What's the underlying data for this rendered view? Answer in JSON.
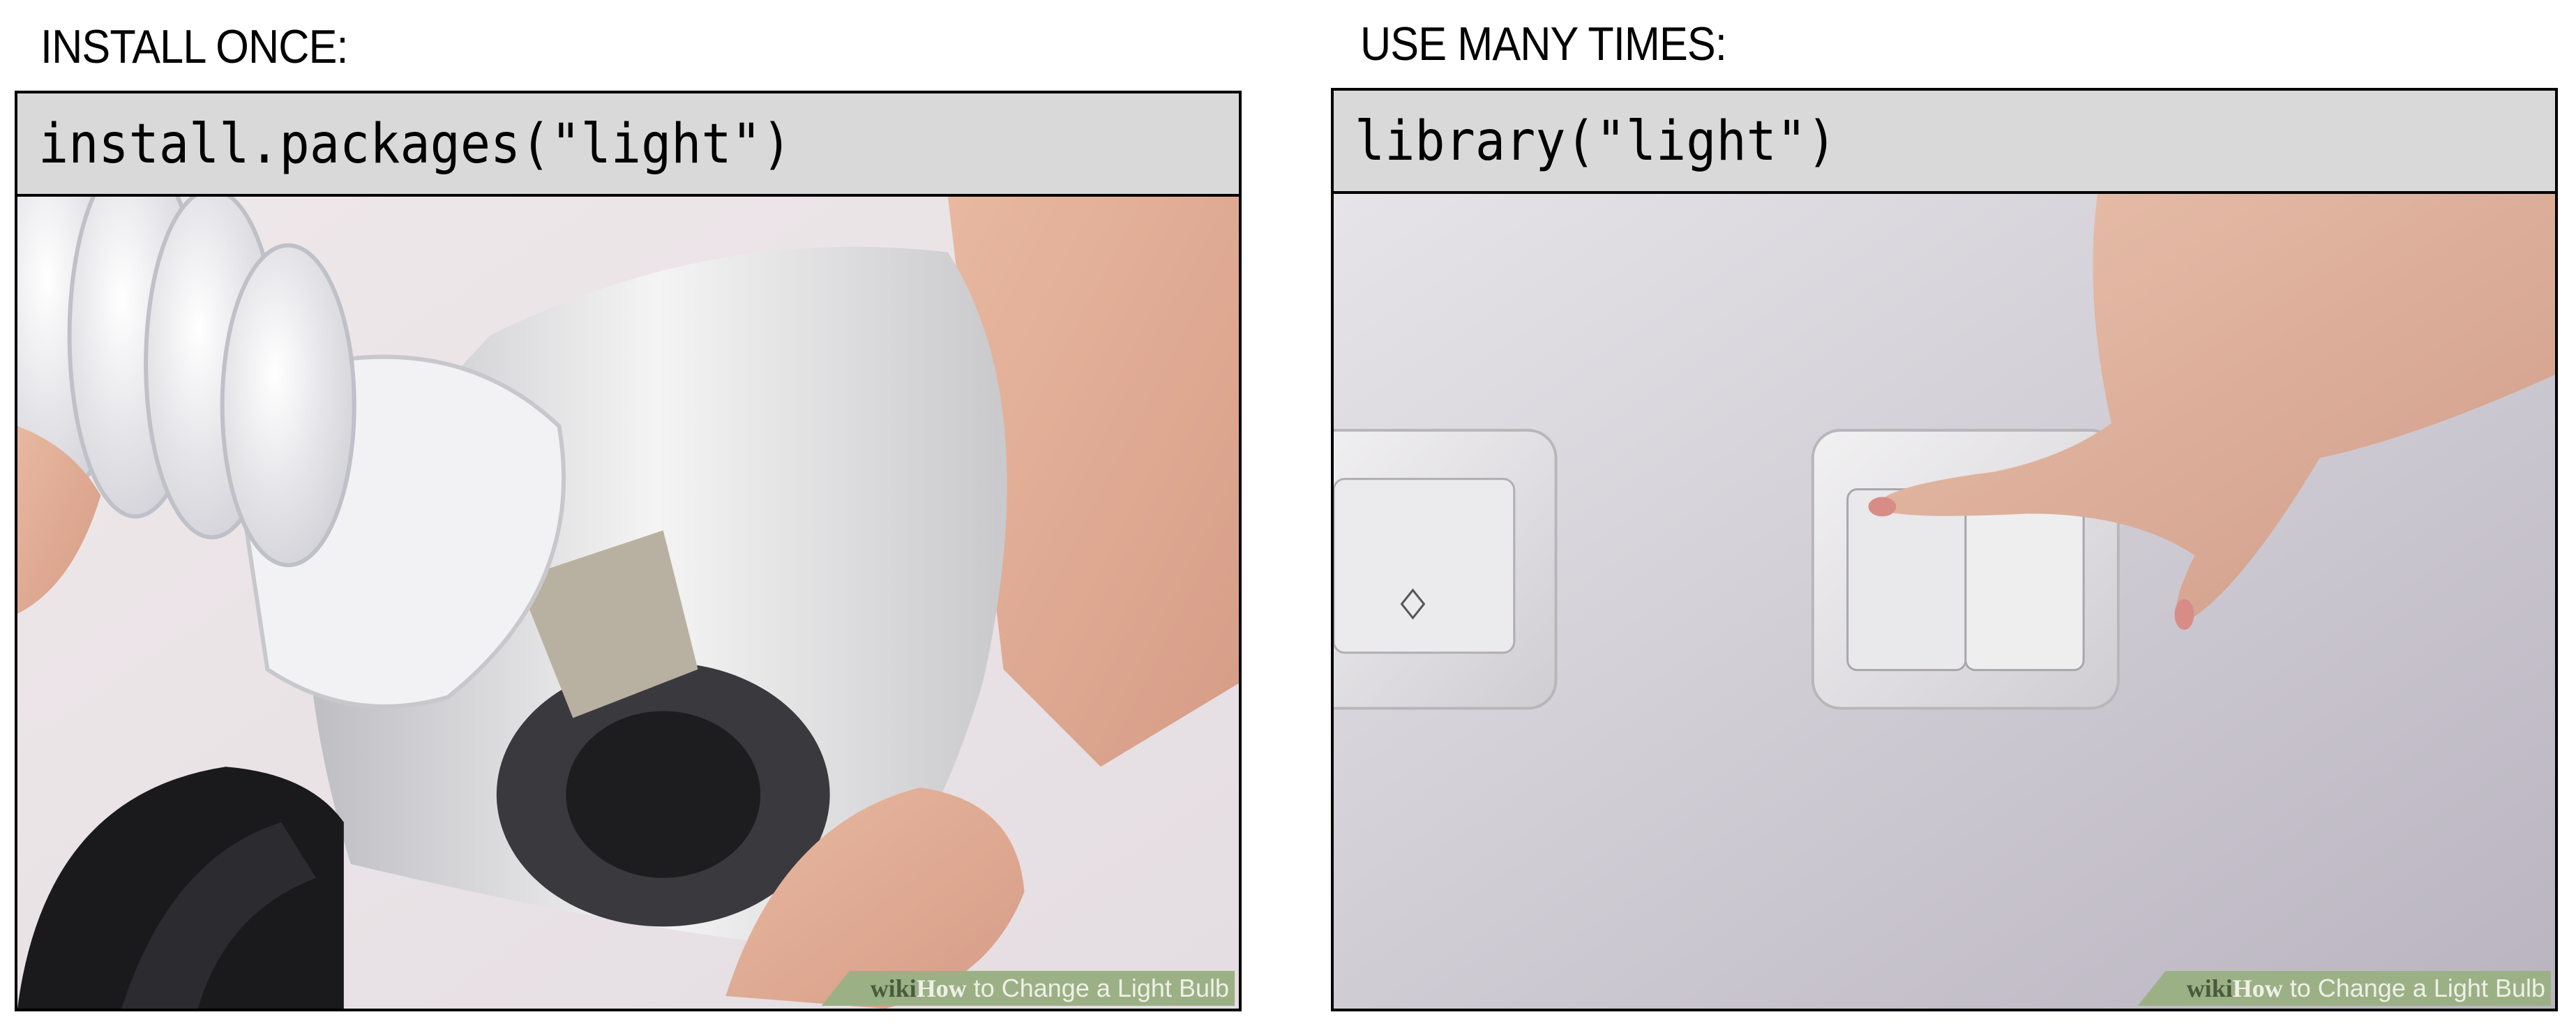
{
  "left": {
    "heading": "INSTALL ONCE:",
    "code": "install.packages(\"light\")",
    "image": "hands screwing a spiral light bulb into a lamp socket",
    "watermark": {
      "brand_a": "wiki",
      "brand_b": "How",
      "caption": " to Change a Light Bulb"
    }
  },
  "right": {
    "heading": "USE MANY TIMES:",
    "code": "library(\"light\")",
    "image": "finger pressing a wall light switch",
    "watermark": {
      "brand_a": "wiki",
      "brand_b": "How",
      "caption": " to Change a Light Bulb"
    }
  },
  "colors": {
    "code_background": "#d9d9d9",
    "watermark_green": "#9cb086"
  }
}
